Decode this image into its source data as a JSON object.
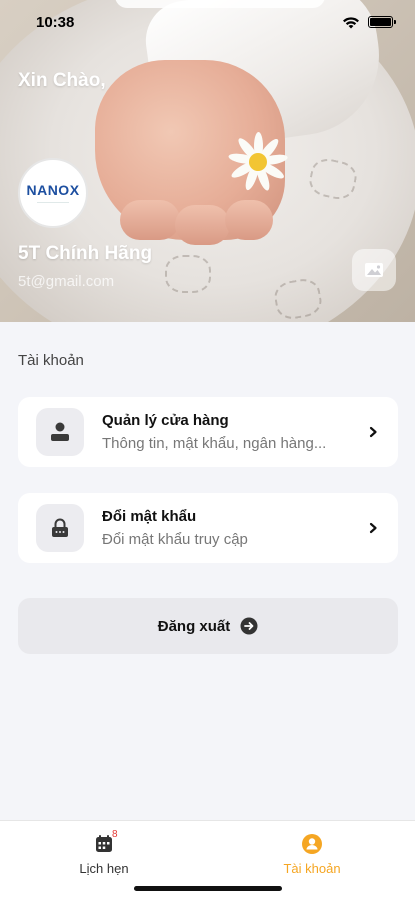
{
  "status_bar": {
    "time": "10:38"
  },
  "header": {
    "greeting": "Xin Chào,",
    "logo_text": "NANOX",
    "store_name": "5T Chính Hãng",
    "email": "5t@gmail.com"
  },
  "account_section": {
    "title": "Tài khoản",
    "items": [
      {
        "title": "Quản lý cửa hàng",
        "subtitle": "Thông tin, mật khẩu, ngân hàng..."
      },
      {
        "title": "Đổi mật khẩu",
        "subtitle": "Đổi mật khẩu truy cập"
      }
    ],
    "logout_label": "Đăng xuất"
  },
  "tab_bar": {
    "tabs": [
      {
        "label": "Lịch hẹn",
        "badge": "8",
        "active": false
      },
      {
        "label": "Tài khoản",
        "active": true
      }
    ]
  },
  "colors": {
    "accent": "#f5a623",
    "inactive": "#333333",
    "badge": "#e53935",
    "background": "#f4f5f9"
  }
}
